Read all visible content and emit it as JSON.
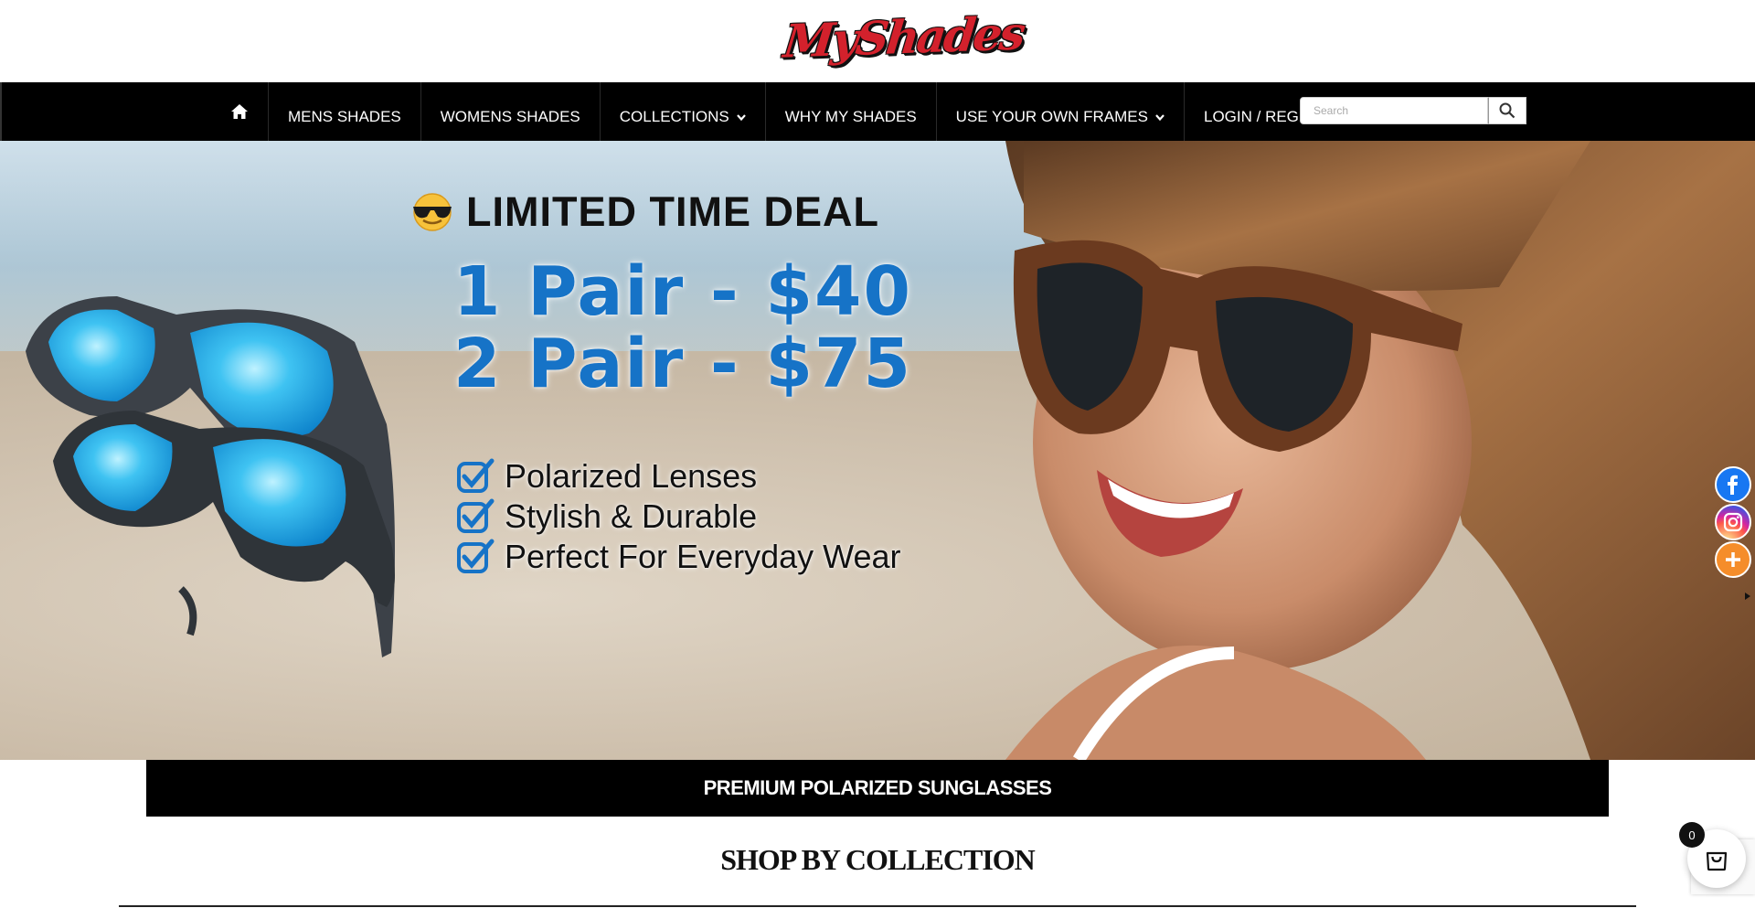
{
  "brand": {
    "logo_text": "MyShades"
  },
  "nav": {
    "home_icon": "home-icon",
    "items": [
      {
        "label": "MENS SHADES",
        "dropdown": false
      },
      {
        "label": "WOMENS SHADES",
        "dropdown": false
      },
      {
        "label": "COLLECTIONS",
        "dropdown": true
      },
      {
        "label": "WHY MY SHADES",
        "dropdown": false
      },
      {
        "label": "USE YOUR OWN FRAMES",
        "dropdown": true
      },
      {
        "label": "LOGIN / REGISTER",
        "dropdown": false
      }
    ],
    "search": {
      "placeholder": "Search",
      "value": "",
      "icon": "search-icon"
    }
  },
  "hero": {
    "deal_emoji": "sunglasses-emoji-icon",
    "deal_heading": "LIMITED TIME DEAL",
    "prices": [
      "1 Pair - $40",
      "2 Pair - $75"
    ],
    "features": [
      "Polarized Lenses",
      "Stylish & Durable",
      "Perfect For Everyday Wear"
    ],
    "check_icon": "checkmark-icon",
    "accent_color": "#1673c7"
  },
  "social": {
    "buttons": [
      "facebook-icon",
      "instagram-icon",
      "plus-icon"
    ],
    "hide_icon": "hide-arrow-icon"
  },
  "promo_strip": {
    "text": "PREMIUM POLARIZED SUNGLASSES"
  },
  "collection": {
    "title": "SHOP BY COLLECTION"
  },
  "cart": {
    "count": "0",
    "icon": "shopping-bag-icon"
  }
}
